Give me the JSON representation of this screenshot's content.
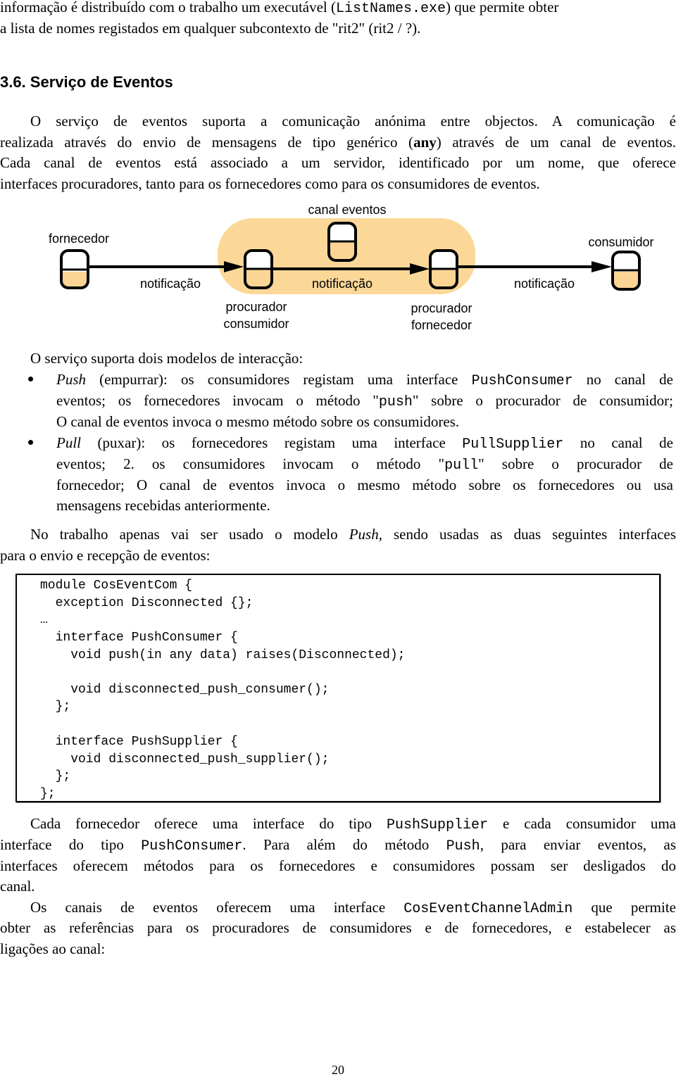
{
  "intro": {
    "line1_a": "informação é distribuído com o trabalho um executável (",
    "line1_code": "ListNames.exe",
    "line1_b": ") que permite obter",
    "line2": "a lista de nomes registados em qualquer subcontexto de \"rit2\" (rit2 / ?)."
  },
  "section": {
    "heading": "3.6. Serviço de Eventos"
  },
  "para1": {
    "line1": "O serviço de eventos suporta a comunicação anónima entre objectos. A comunicação é",
    "line2_a": "realizada através do envio de mensagens de tipo genérico (",
    "line2_bold": "any",
    "line2_b": ") através de um canal de eventos.",
    "line3": "Cada canal de eventos está associado a um servidor, identificado por um nome, que oferece",
    "line4": "interfaces procuradores, tanto para os fornecedores como para os consumidores de eventos."
  },
  "diagram": {
    "channel_label": "canal eventos",
    "supplier_label": "fornecedor",
    "consumer_label": "consumidor",
    "proxy_consumer_label": [
      "procurador",
      "consumidor"
    ],
    "proxy_supplier_label": [
      "procurador",
      "fornecedor"
    ],
    "edge_labels": [
      "notificação",
      "notificação",
      "notificação"
    ],
    "colors": {
      "channel_fill": "#fbd898",
      "node_fill": "#fcd594",
      "stroke": "#000000"
    }
  },
  "models": {
    "intro": "O serviço suporta dois modelos de interacção:",
    "push": {
      "term": "Push",
      "l1_a": " (empurrar): os consumidores registam uma interface ",
      "l1_code": "PushConsumer",
      "l1_b": " no canal de",
      "l2_a": "eventos; os fornecedores invocam o método \"",
      "l2_code": "push",
      "l2_b": "\" sobre o procurador de consumidor;",
      "l3": "O canal de eventos invoca o mesmo método sobre os consumidores."
    },
    "pull": {
      "term": "Pull",
      "l1_a": " (puxar): os fornecedores registam uma interface ",
      "l1_code": "PullSupplier",
      "l1_b": " no canal de",
      "l2_a": "eventos; 2. os consumidores invocam o método \"",
      "l2_code": "pull",
      "l2_b": "\" sobre o procurador de",
      "l3": "fornecedor; O canal de eventos invoca o mesmo método sobre os fornecedores ou usa",
      "l4": "mensagens recebidas anteriormente."
    }
  },
  "para2": {
    "l1_a": "No trabalho apenas vai ser usado o modelo ",
    "l1_em": "Push",
    "l1_b": ", sendo usadas as duas seguintes interfaces",
    "l2": "para o envio e recepção de eventos:"
  },
  "code": {
    "lines": [
      "module CosEventCom {",
      "  exception Disconnected {};",
      "…",
      "  interface PushConsumer {",
      "    void push(in any data) raises(Disconnected);",
      "",
      "    void disconnected_push_consumer();",
      "  };",
      "",
      "  interface PushSupplier {",
      "    void disconnected_push_supplier();",
      "  };",
      "};"
    ]
  },
  "para3": {
    "l1_a": "Cada fornecedor oferece uma interface do tipo ",
    "l1_code": "PushSupplier",
    "l1_b": " e cada consumidor uma",
    "l2_a": "interface do tipo ",
    "l2_code1": "PushConsumer",
    "l2_b": ". Para além do método ",
    "l2_code2": "Push",
    "l2_c": ", para enviar eventos, as",
    "l3": "interfaces oferecem métodos para os fornecedores e consumidores possam ser desligados do",
    "l4": "canal."
  },
  "para4": {
    "l1_a": "Os canais de eventos oferecem uma interface ",
    "l1_code": "CosEventChannelAdmin",
    "l1_b": " que permite",
    "l2": "obter as referências para os procuradores de consumidores e de fornecedores, e estabelecer as",
    "l3": "ligações ao canal:"
  },
  "page_number": "20"
}
